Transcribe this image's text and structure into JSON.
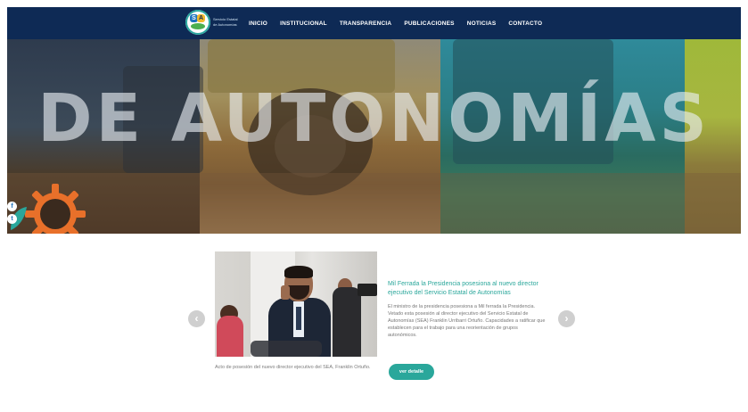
{
  "header": {
    "logo_lines": [
      "Servicio Estatal",
      "de Autonomías"
    ],
    "menu": [
      "INICIO",
      "INSTITUCIONAL",
      "TRANSPARENCIA",
      "PUBLICACIONES",
      "NOTICIAS",
      "CONTACTO"
    ]
  },
  "hero": {
    "title": "DE AUTONOMÍAS"
  },
  "social": [
    "f",
    "t"
  ],
  "news": {
    "title": "Mil Ferrada la Presidencia posesiona al nuevo director ejecutivo del Servicio Estatal de Autonomías",
    "excerpt": "El ministro de la presidencia posesiona a Mil ferrada la Presidencia. Vetado esta posesión al director ejecutivo del Servicio Estatal de Autonomías (SEA) Franklin Urribarri Ortuño. Capacidades a ratificar que establecen para el trabajo para una reorientación de grupos autonómicos.",
    "caption": "Acto de posesión del nuevo director ejecutivo del SEA, Franklin Ortuño.",
    "button_label": "ver detalle",
    "prev_symbol": "‹",
    "next_symbol": "›"
  }
}
